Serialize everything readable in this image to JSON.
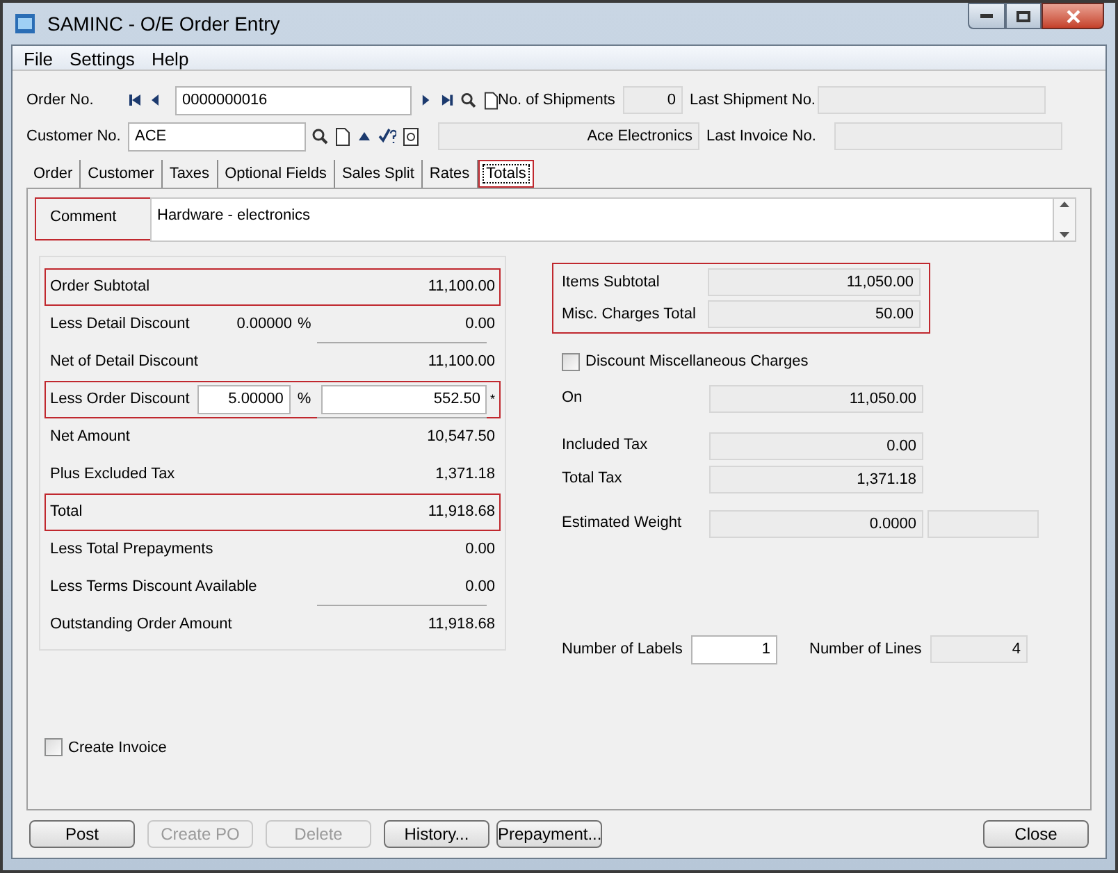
{
  "window": {
    "title": "SAMINC - O/E Order Entry"
  },
  "menu": [
    "File",
    "Settings",
    "Help"
  ],
  "header": {
    "order_no": {
      "label": "Order No.",
      "value": "0000000016"
    },
    "shipments": {
      "label": "No. of Shipments",
      "value": "0"
    },
    "last_shipment": {
      "label": "Last Shipment No."
    },
    "customer_no": {
      "label": "Customer No.",
      "value": "ACE"
    },
    "customer_name": {
      "value": "Ace Electronics"
    },
    "last_invoice": {
      "label": "Last Invoice No."
    }
  },
  "tabs": [
    {
      "label": "Order",
      "selected": false,
      "highlighted": false
    },
    {
      "label": "Customer",
      "selected": false,
      "highlighted": false
    },
    {
      "label": "Taxes",
      "selected": false,
      "highlighted": false
    },
    {
      "label": "Optional Fields",
      "selected": false,
      "highlighted": false
    },
    {
      "label": "Sales Split",
      "selected": false,
      "highlighted": false
    },
    {
      "label": "Rates",
      "selected": false,
      "highlighted": false
    },
    {
      "label": "Totals",
      "selected": true,
      "highlighted": true
    }
  ],
  "comment": {
    "label": "Comment",
    "value": "Hardware - electronics",
    "highlighted": true
  },
  "left_totals": [
    {
      "kind": "plain",
      "label": "Order Subtotal",
      "amount": "11,100.00",
      "highlighted": true,
      "underlined": false
    },
    {
      "kind": "percent",
      "label": "Less Detail Discount",
      "percent": "0.00000",
      "percent_sign": "%",
      "amount": "0.00",
      "highlighted": false,
      "underlined": true
    },
    {
      "kind": "plain",
      "label": "Net of Detail Discount",
      "amount": "11,100.00",
      "highlighted": false,
      "underlined": false
    },
    {
      "kind": "edit",
      "label": "Less Order Discount",
      "percent": "5.00000",
      "percent_sign": "%",
      "amount": "552.50",
      "marker": "*",
      "highlighted": true,
      "underlined": true
    },
    {
      "kind": "plain",
      "label": "Net Amount",
      "amount": "10,547.50",
      "highlighted": false,
      "underlined": false
    },
    {
      "kind": "plain",
      "label": "Plus Excluded Tax",
      "amount": "1,371.18",
      "highlighted": false,
      "underlined": false
    },
    {
      "kind": "plain",
      "label": "Total",
      "amount": "11,918.68",
      "highlighted": true,
      "underlined": false
    },
    {
      "kind": "plain",
      "label": "Less Total Prepayments",
      "amount": "0.00",
      "highlighted": false,
      "underlined": false
    },
    {
      "kind": "plain",
      "label": "Less Terms Discount Available",
      "amount": "0.00",
      "highlighted": false,
      "underlined": true
    },
    {
      "kind": "plain",
      "label": "Outstanding Order Amount",
      "amount": "11,918.68",
      "highlighted": false,
      "underlined": false
    }
  ],
  "right_summary": [
    {
      "label": "Items Subtotal",
      "value": "11,050.00"
    },
    {
      "label": "Misc. Charges Total",
      "value": "50.00"
    }
  ],
  "discount_misc": {
    "label": "Discount Miscellaneous Charges",
    "checked": false
  },
  "right_fields": [
    {
      "label": "On",
      "value": "11,050.00"
    },
    {
      "label": "Included Tax",
      "value": "0.00"
    },
    {
      "label": "Total Tax",
      "value": "1,371.18"
    },
    {
      "label": "Estimated Weight",
      "value": "0.0000"
    }
  ],
  "labels": {
    "label": "Number of Labels",
    "value": "1"
  },
  "lines": {
    "label": "Number of Lines",
    "value": "4"
  },
  "create_invoice": {
    "label": "Create Invoice",
    "checked": false
  },
  "buttons": [
    {
      "label": "Post",
      "disabled": false
    },
    {
      "label": "Create PO",
      "disabled": true
    },
    {
      "label": "Delete",
      "disabled": true
    },
    {
      "label": "History...",
      "disabled": false
    },
    {
      "label": "Prepayment...",
      "disabled": false
    }
  ],
  "close_button": {
    "label": "Close",
    "disabled": false
  }
}
